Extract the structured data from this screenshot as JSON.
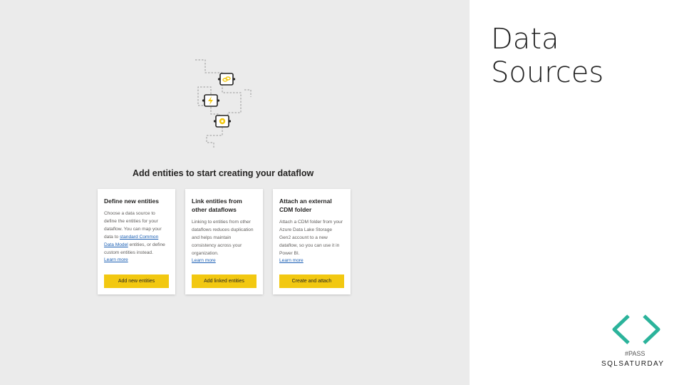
{
  "slide": {
    "title_line1": "Data",
    "title_line2": "Sources"
  },
  "dataflow": {
    "heading": "Add entities to start creating your dataflow",
    "cards": [
      {
        "title": "Define new entities",
        "body_before_link": "Choose a data source to define the entities for your dataflow. You can map your data to ",
        "body_link": "standard Common Data Model",
        "body_after_link": " entities, or define custom entities instead.",
        "learn_more": "Learn more",
        "button": "Add new entities"
      },
      {
        "title": "Link entities from other dataflows",
        "body": "Linking to entities from other dataflows reduces duplication and helps maintain consistency across your organization.",
        "learn_more": "Learn more",
        "button": "Add linked entities"
      },
      {
        "title": "Attach an external CDM folder",
        "body": "Attach a CDM folder from your Azure Data Lake Storage Gen2 account to a new dataflow, so you can use it in Power BI.",
        "learn_more": "Learn more",
        "button": "Create and attach"
      }
    ]
  },
  "illustration": {
    "icons": [
      "link-icon",
      "lightning-icon",
      "gear-icon"
    ],
    "accent_color": "#f2c811"
  },
  "branding": {
    "pass_label": "#PASS",
    "sqlsaturday_label": "SQLSATURDAY",
    "logo_color": "#2bb39b"
  }
}
